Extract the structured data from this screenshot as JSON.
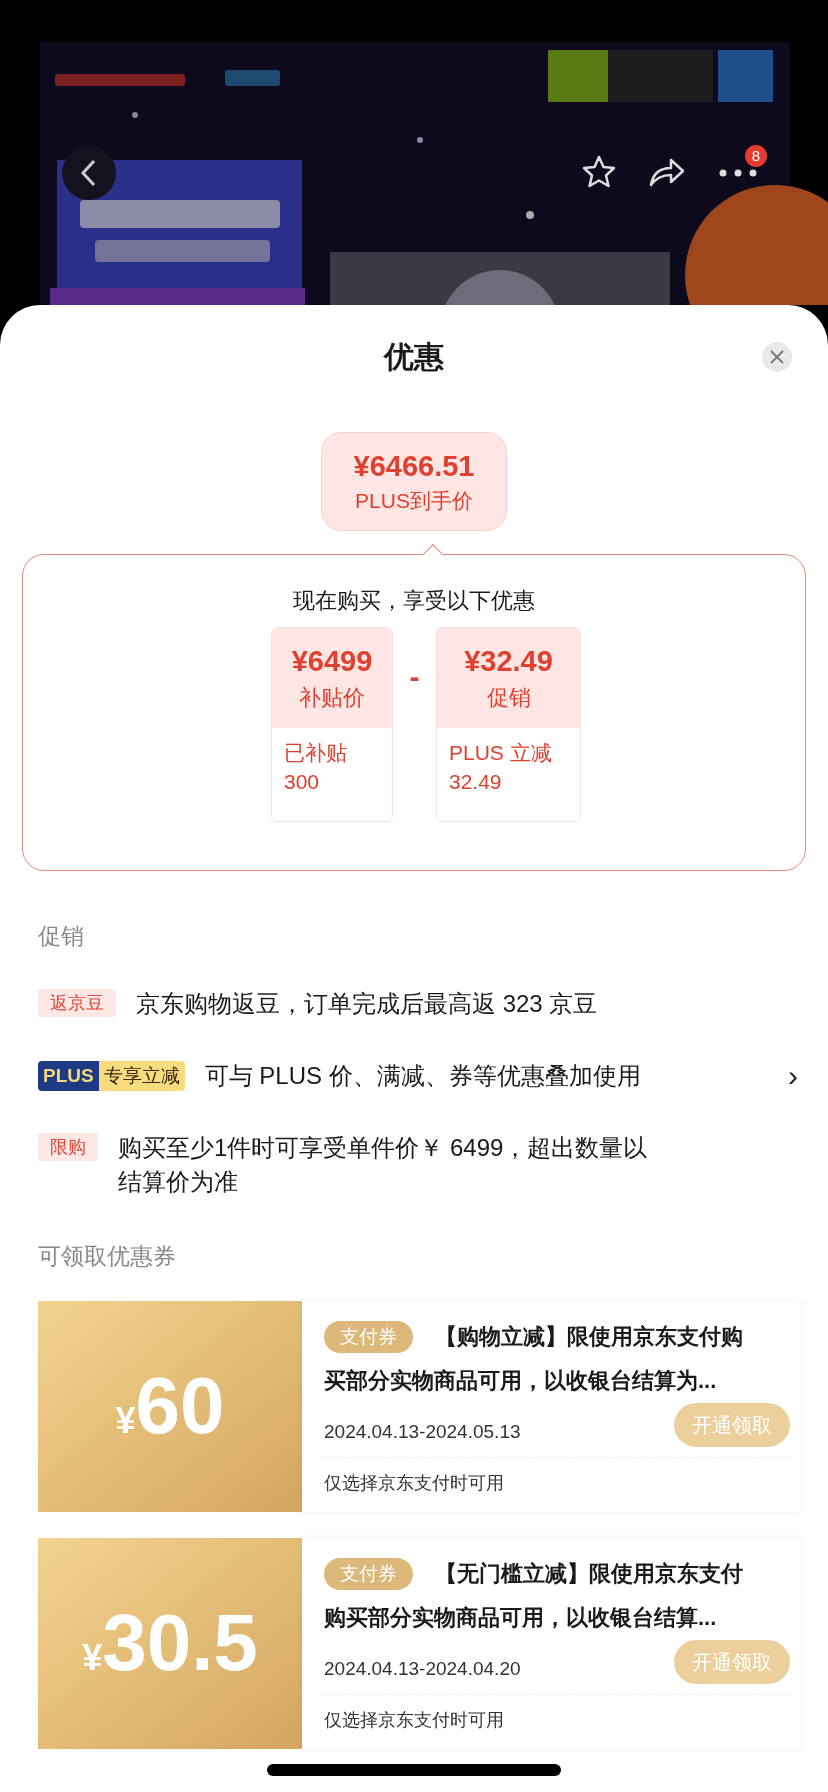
{
  "header": {
    "badge": "8"
  },
  "sheet": {
    "title": "优惠"
  },
  "final_price": {
    "amount": "¥6466.51",
    "label": "PLUS到手价"
  },
  "breakdown": {
    "heading": "现在购买，享受以下优惠",
    "operator": "-",
    "items": [
      {
        "amount": "¥6499",
        "label": "补贴价",
        "detail": [
          "已补贴",
          "300"
        ]
      },
      {
        "amount": "¥32.49",
        "label": "促销",
        "detail": [
          "PLUS 立减",
          "32.49"
        ]
      }
    ]
  },
  "promotions": {
    "title": "促销",
    "items": [
      {
        "kind": "tag",
        "tag": "返京豆",
        "text": "京东购物返豆，订单完成后最高返 323 京豆"
      },
      {
        "kind": "plus",
        "tag": "PLUS",
        "tag_extra": "专享立减",
        "text": "可与 PLUS 价、满减、券等优惠叠加使用",
        "arrow": "›"
      },
      {
        "kind": "tag",
        "tag": "限购",
        "text": "购买至少1件时可享受单件价￥ 6499，超出数量以结算价为准"
      }
    ]
  },
  "coupons": {
    "title": "可领取优惠券",
    "items": [
      {
        "currency": "¥",
        "amount": "60",
        "tag": "支付券",
        "title_lines": [
          "【购物立减】限使用京东支付购",
          "买部分实物商品可用，以收银台结算为..."
        ],
        "dates": "2024.04.13-2024.05.13",
        "button": "开通领取",
        "note": "仅选择京东支付时可用"
      },
      {
        "currency": "¥",
        "amount": "30.5",
        "tag": "支付券",
        "title_lines": [
          "【无门槛立减】限使用京东支付",
          "购买部分实物商品可用，以收银台结算..."
        ],
        "dates": "2024.04.13-2024.04.20",
        "button": "开通领取",
        "note": "仅选择京东支付时可用"
      }
    ]
  }
}
